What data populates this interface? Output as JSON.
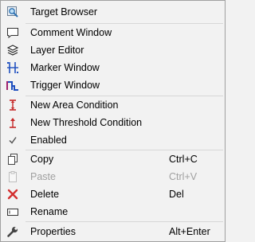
{
  "menu": {
    "items": {
      "target_browser": {
        "label": "Target Browser",
        "icon": "target-browser-icon"
      },
      "comment_window": {
        "label": "Comment Window",
        "icon": "comment-icon"
      },
      "layer_editor": {
        "label": "Layer Editor",
        "icon": "layers-icon"
      },
      "marker_window": {
        "label": "Marker Window",
        "icon": "marker-icon"
      },
      "trigger_window": {
        "label": "Trigger Window",
        "icon": "trigger-icon"
      },
      "new_area_condition": {
        "label": "New Area Condition",
        "icon": "area-condition-icon"
      },
      "new_threshold_condition": {
        "label": "New Threshold Condition",
        "icon": "threshold-condition-icon"
      },
      "enabled": {
        "label": "Enabled",
        "icon": "check-icon",
        "checked": true
      },
      "copy": {
        "label": "Copy",
        "shortcut": "Ctrl+C",
        "icon": "copy-icon"
      },
      "paste": {
        "label": "Paste",
        "shortcut": "Ctrl+V",
        "icon": "paste-icon",
        "disabled": true
      },
      "delete": {
        "label": "Delete",
        "shortcut": "Del",
        "icon": "delete-icon"
      },
      "rename": {
        "label": "Rename",
        "icon": "rename-icon"
      },
      "properties": {
        "label": "Properties",
        "shortcut": "Alt+Enter",
        "icon": "wrench-icon"
      }
    }
  }
}
